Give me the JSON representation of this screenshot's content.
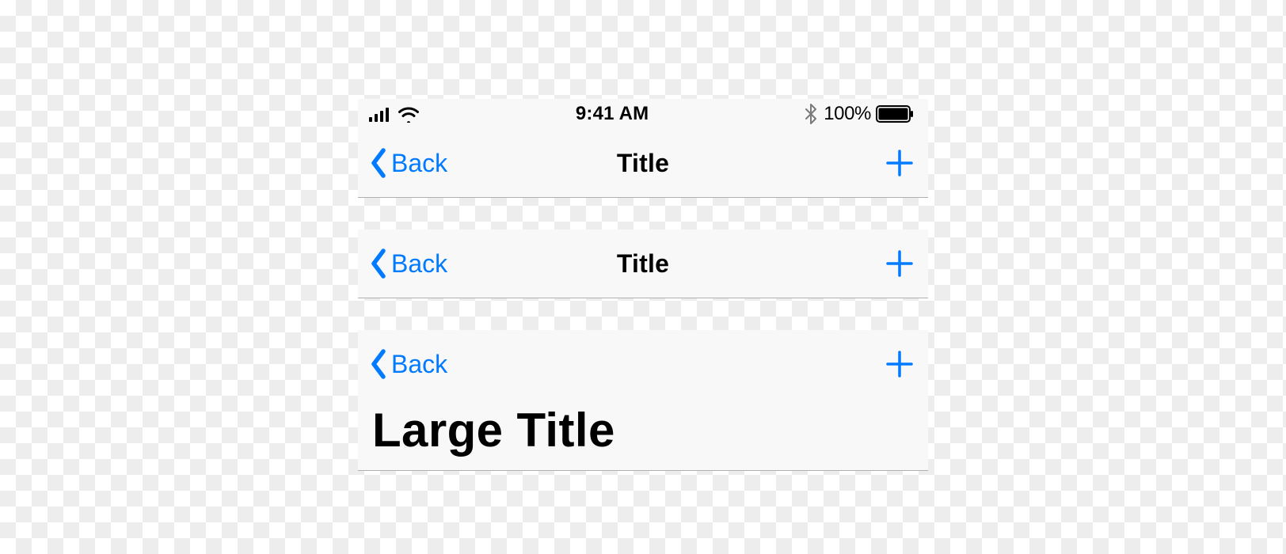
{
  "status": {
    "time": "9:41 AM",
    "battery_percent": "100%"
  },
  "bars": [
    {
      "back_label": "Back",
      "title": "Title"
    },
    {
      "back_label": "Back",
      "title": "Title"
    },
    {
      "back_label": "Back",
      "large_title": "Large Title"
    }
  ]
}
